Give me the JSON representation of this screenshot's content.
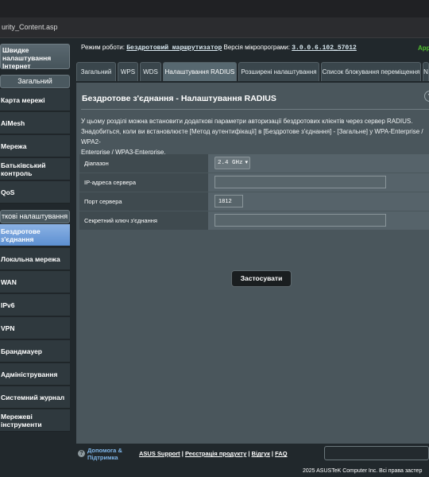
{
  "browser": {
    "url_fragment": "urity_Content.asp"
  },
  "header": {
    "mode_label": "Режим роботи:",
    "mode_value": "Бездротовий маршрутизатор",
    "firmware_label": "Версія мікропрограми:",
    "firmware_value": "3.0.0.6.102_57012",
    "app_link": "App"
  },
  "sidebar": {
    "qis": "Швидке налаштування Інтернет",
    "general_head": "Загальний",
    "general_items": [
      "Карта мережі",
      "AiMesh",
      "Мережа",
      "Батьківський контроль",
      "QoS"
    ],
    "advanced_head": "ткові налаштування",
    "advanced_items": [
      "Бездротове з'єднання",
      "Локальна мережа",
      "WAN",
      "IPv6",
      "VPN",
      "Брандмауер",
      "Адміністрування",
      "Системний журнал",
      "Мережеві інструменти"
    ]
  },
  "tabs": [
    "Загальний",
    "WPS",
    "WDS",
    "Налаштування RADIUS",
    "Розширені налаштування",
    "Список блокування переміщення",
    "N"
  ],
  "panel": {
    "title": "Бездротове з'єднання - Налаштування RADIUS",
    "help_icon": "?",
    "desc_line1": "У цьому розділі можна встановити додаткові параметри авторизації бездротових клієнтів через сервер RADIUS.",
    "desc_line2": "Знадобиться, коли ви встановлюєте [Метод аутентифікації] в [Бездротове з'єднання] - [Загальне] у WPA-Enterprise / WPA2-",
    "desc_line3": "Enterprise / WPA3-Enterprise.",
    "band_label": "Діапазон",
    "band_value": "2.4 GHz",
    "ip_label": "IP-адреса сервера",
    "ip_value": "",
    "port_label": "Порт сервера",
    "port_value": "1812",
    "secret_label": "Секретний ключ з'єднання",
    "secret_value": "",
    "apply_label": "Застосувати"
  },
  "footer": {
    "help_line1": "Допомога &",
    "help_line2": "Підтримка",
    "link_support": "ASUS Support",
    "link_register": "Реєстрація продукту",
    "link_feedback": "Відгук",
    "link_faq": "FAQ",
    "copyright": "2025 ASUSTeK Computer Inc. Всі права застер"
  }
}
